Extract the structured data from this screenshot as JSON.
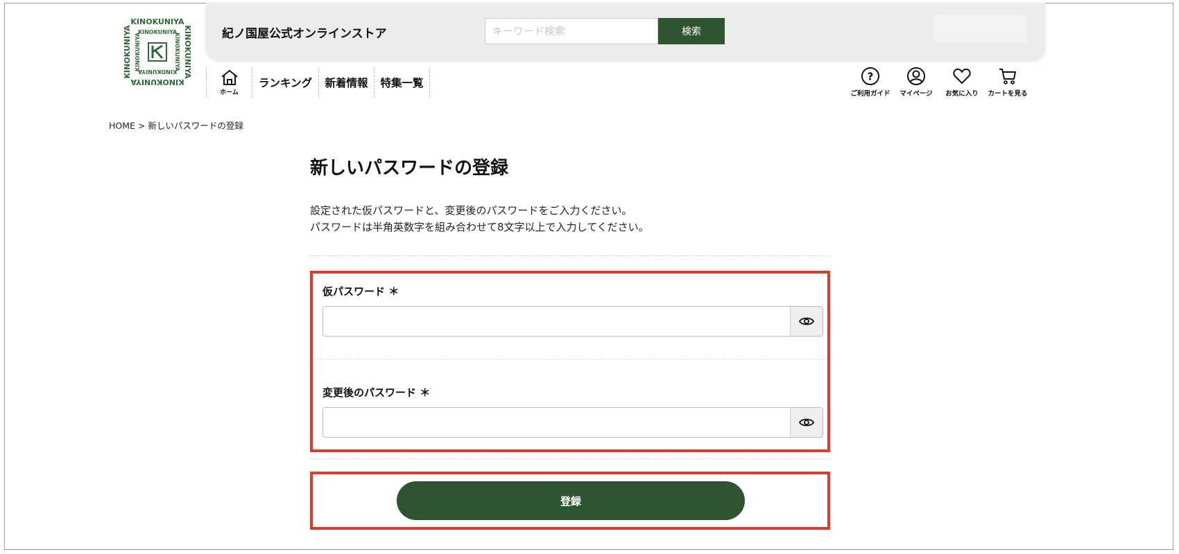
{
  "header": {
    "logo_text": "KINOKUNIYA",
    "store_name": "紀ノ国屋公式オンラインストア",
    "search": {
      "placeholder": "キーワード検索",
      "button_label": "検索"
    }
  },
  "nav": {
    "home_label": "ホーム",
    "items": [
      {
        "label": "ランキング"
      },
      {
        "label": "新着情報"
      },
      {
        "label": "特集一覧"
      }
    ]
  },
  "utility_icons": [
    {
      "icon": "help-circle-icon",
      "label": "ご利用ガイド"
    },
    {
      "icon": "user-icon",
      "label": "マイページ"
    },
    {
      "icon": "heart-icon",
      "label": "お気に入り"
    },
    {
      "icon": "cart-icon",
      "label": "カートを見る"
    }
  ],
  "breadcrumb": {
    "home": "HOME",
    "separator": ">",
    "current": "新しいパスワードの登録"
  },
  "page": {
    "title": "新しいパスワードの登録",
    "description": [
      "設定された仮パスワードと、変更後のパスワードをご入力ください。",
      "パスワードは半角英数字を組み合わせて8文字以上で入力してください。"
    ]
  },
  "form": {
    "temp_password": {
      "label": "仮パスワード",
      "required_mark": "＊",
      "value": ""
    },
    "new_password": {
      "label": "変更後のパスワード",
      "required_mark": "＊",
      "value": ""
    },
    "submit_label": "登録"
  },
  "colors": {
    "brand_green": "#2e5430",
    "highlight_red": "#e03a2b",
    "header_bg": "#ececec"
  }
}
